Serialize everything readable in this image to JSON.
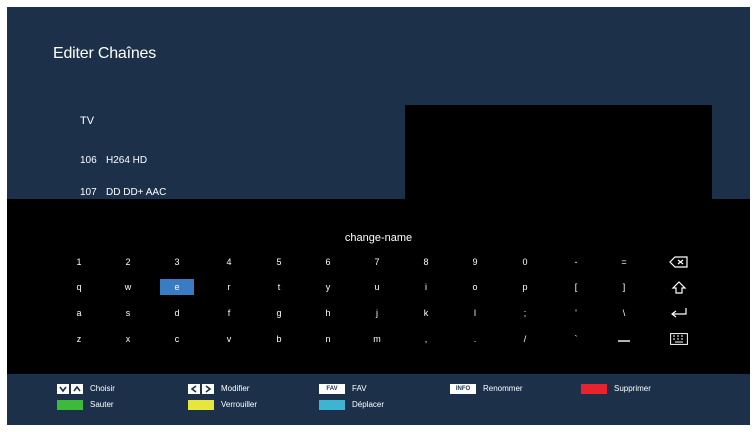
{
  "header": {
    "title": "Editer Chaînes"
  },
  "channel_list": {
    "group": "TV",
    "channels": [
      {
        "number": "106",
        "name": "H264 HD"
      },
      {
        "number": "107",
        "name": "DD DD+ AAC"
      }
    ]
  },
  "keyboard": {
    "title": "change-name",
    "rows": [
      [
        "1",
        "2",
        "3",
        "4",
        "5",
        "6",
        "7",
        "8",
        "9",
        "0",
        "-",
        "="
      ],
      [
        "q",
        "w",
        "e",
        "r",
        "t",
        "y",
        "u",
        "i",
        "o",
        "p",
        "[",
        "]"
      ],
      [
        "a",
        "s",
        "d",
        "f",
        "g",
        "h",
        "j",
        "k",
        "l",
        ";",
        "'",
        "\\"
      ],
      [
        "z",
        "x",
        "c",
        "v",
        "b",
        "n",
        "m",
        ",",
        ".",
        "/",
        "`",
        ""
      ]
    ],
    "selected": "e",
    "special_keys": [
      "backspace-icon",
      "shift-icon",
      "enter-icon",
      "keyboard-icon"
    ],
    "space_icon": "space-icon"
  },
  "legend": {
    "choisir": "Choisir",
    "modifier": "Modifier",
    "fav_badge": "FAV",
    "fav": "FAV",
    "info_badge": "INFO",
    "renommer": "Renommer",
    "supprimer": "Supprimer",
    "sauter": "Sauter",
    "verrouiller": "Verrouiller",
    "deplacer": "Déplacer",
    "colors": {
      "red": "#e8232d",
      "green": "#3cba3c",
      "yellow": "#e6e63c",
      "blue": "#3cb4d2"
    }
  }
}
